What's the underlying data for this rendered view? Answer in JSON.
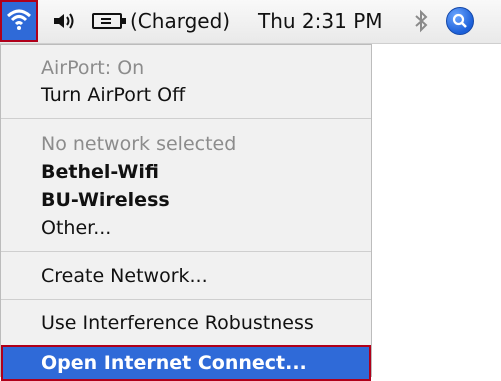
{
  "menubar": {
    "wifi_icon": "wifi-icon",
    "speaker_icon": "speaker-icon",
    "battery_icon": "battery-icon",
    "battery_status": "(Charged)",
    "clock": "Thu 2:31 PM",
    "bluetooth_icon": "bluetooth-icon",
    "spotlight_icon": "spotlight-icon"
  },
  "menu": {
    "airport_status": "AirPort: On",
    "turn_off": "Turn AirPort Off",
    "no_network": "No network selected",
    "networks": [
      "Bethel-Wifi",
      "BU-Wireless"
    ],
    "other": "Other...",
    "create_network": "Create Network...",
    "interference": "Use Interference Robustness",
    "open_internet_connect": "Open Internet Connect..."
  },
  "colors": {
    "accent": "#2f6ad8",
    "highlight_outline": "#b0001a",
    "menu_bg": "#f1f1f1",
    "disabled_text": "#8c8c8c"
  }
}
